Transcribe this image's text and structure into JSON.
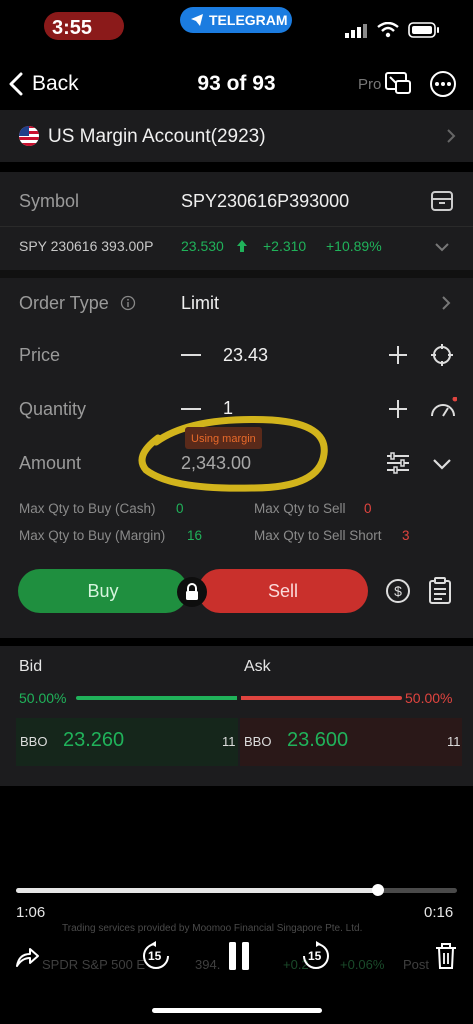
{
  "status": {
    "time": "3:55",
    "pill": "TELEGRAM"
  },
  "nav": {
    "back": "Back",
    "title": "93 of 93",
    "pro": "Pro"
  },
  "account": {
    "name": "US Margin Account(2923)"
  },
  "symbol": {
    "label": "Symbol",
    "value": "SPY230616P393000"
  },
  "quote": {
    "name": "SPY 230616 393.00P",
    "price": "23.530",
    "change": "+2.310",
    "pct": "+10.89%"
  },
  "order_type": {
    "label": "Order Type",
    "value": "Limit"
  },
  "price": {
    "label": "Price",
    "value": "23.43"
  },
  "quantity": {
    "label": "Quantity",
    "value": "1"
  },
  "amount": {
    "label": "Amount",
    "value": "2,343.00",
    "badge": "Using margin"
  },
  "limits": {
    "buy_cash_label": "Max Qty to Buy (Cash)",
    "buy_cash": "0",
    "sell_label": "Max Qty to Sell",
    "sell": "0",
    "buy_margin_label": "Max Qty to Buy (Margin)",
    "buy_margin": "16",
    "sell_short_label": "Max Qty to Sell Short",
    "sell_short": "3"
  },
  "actions": {
    "buy": "Buy",
    "sell": "Sell"
  },
  "book": {
    "bid_label": "Bid",
    "ask_label": "Ask",
    "bid_pct": "50.00%",
    "ask_pct": "50.00%",
    "bid_ratio": 0.5,
    "bbo": "BBO",
    "bid_price": "23.260",
    "bid_size": "11",
    "ask_price": "23.600",
    "ask_size": "11"
  },
  "video": {
    "elapsed": "1:06",
    "remaining": "0:16",
    "progress": 0.82,
    "skip": "15"
  },
  "footer": {
    "disclaimer": "Trading services provided by Moomoo Financial Singapore Pte. Ltd.",
    "ticker_name": "SPDR S&P 500 E",
    "ticker_price": "394.",
    "ticker_change": "+0.2",
    "ticker_pct": "+0.06%",
    "ticker_tag": "Post"
  },
  "colors": {
    "buy": "#1f8f3f",
    "sell": "#c9302c",
    "green": "#20b25a",
    "red": "#e0443f",
    "highlight": "#e7c51c"
  }
}
